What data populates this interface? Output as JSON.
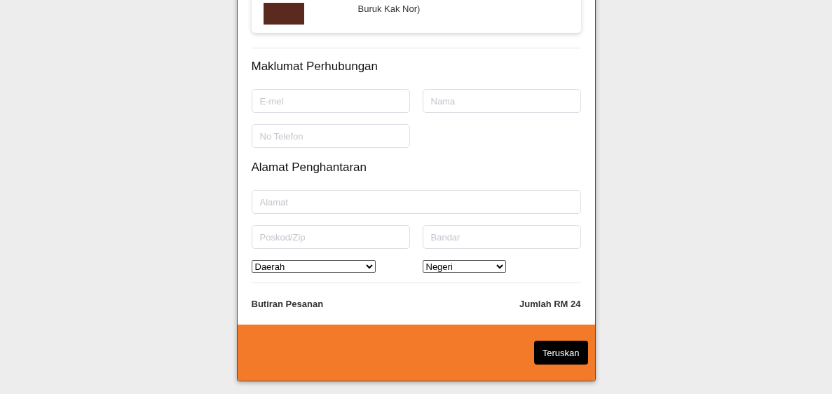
{
  "product": {
    "name": "Buruk Kak Nor)"
  },
  "contact": {
    "heading": "Maklumat Perhubungan",
    "fields": [
      {
        "placeholder": "E-mel"
      },
      {
        "placeholder": "Nama"
      },
      {
        "placeholder": "No Telefon"
      }
    ]
  },
  "delivery": {
    "heading": "Alamat Penghantaran",
    "address": {
      "placeholder": "Alamat"
    },
    "fields": [
      {
        "placeholder": "Poskod/Zip"
      },
      {
        "placeholder": "Bandar"
      }
    ],
    "selects": [
      {
        "value": "Daerah"
      },
      {
        "value": "Negeri"
      }
    ]
  },
  "summary": {
    "label": "Butiran Pesanan",
    "total": "Jumlah RM 24"
  },
  "footer": {
    "button": "Teruskan"
  }
}
